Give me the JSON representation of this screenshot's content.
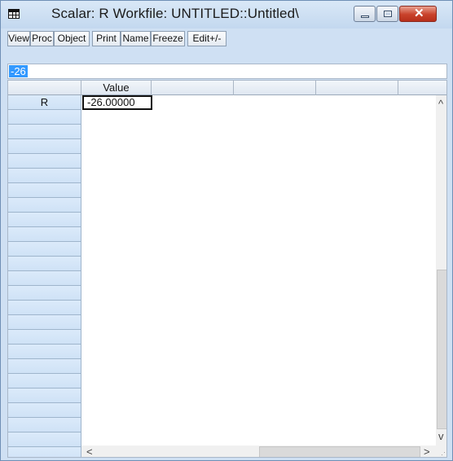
{
  "window": {
    "title": "Scalar: R   Workfile: UNTITLED::Untitled\\"
  },
  "toolbar": {
    "buttons": [
      "View",
      "Proc",
      "Object",
      "Print",
      "Name",
      "Freeze",
      "Edit+/-"
    ]
  },
  "edit_line": {
    "value": "-26"
  },
  "grid": {
    "column_header": "Value",
    "row_label": "R",
    "cell_value": "-26.00000"
  },
  "colors": {
    "selection": "#3399ff",
    "row_header": "#d6e6f6",
    "close_button": "#c8412a"
  }
}
